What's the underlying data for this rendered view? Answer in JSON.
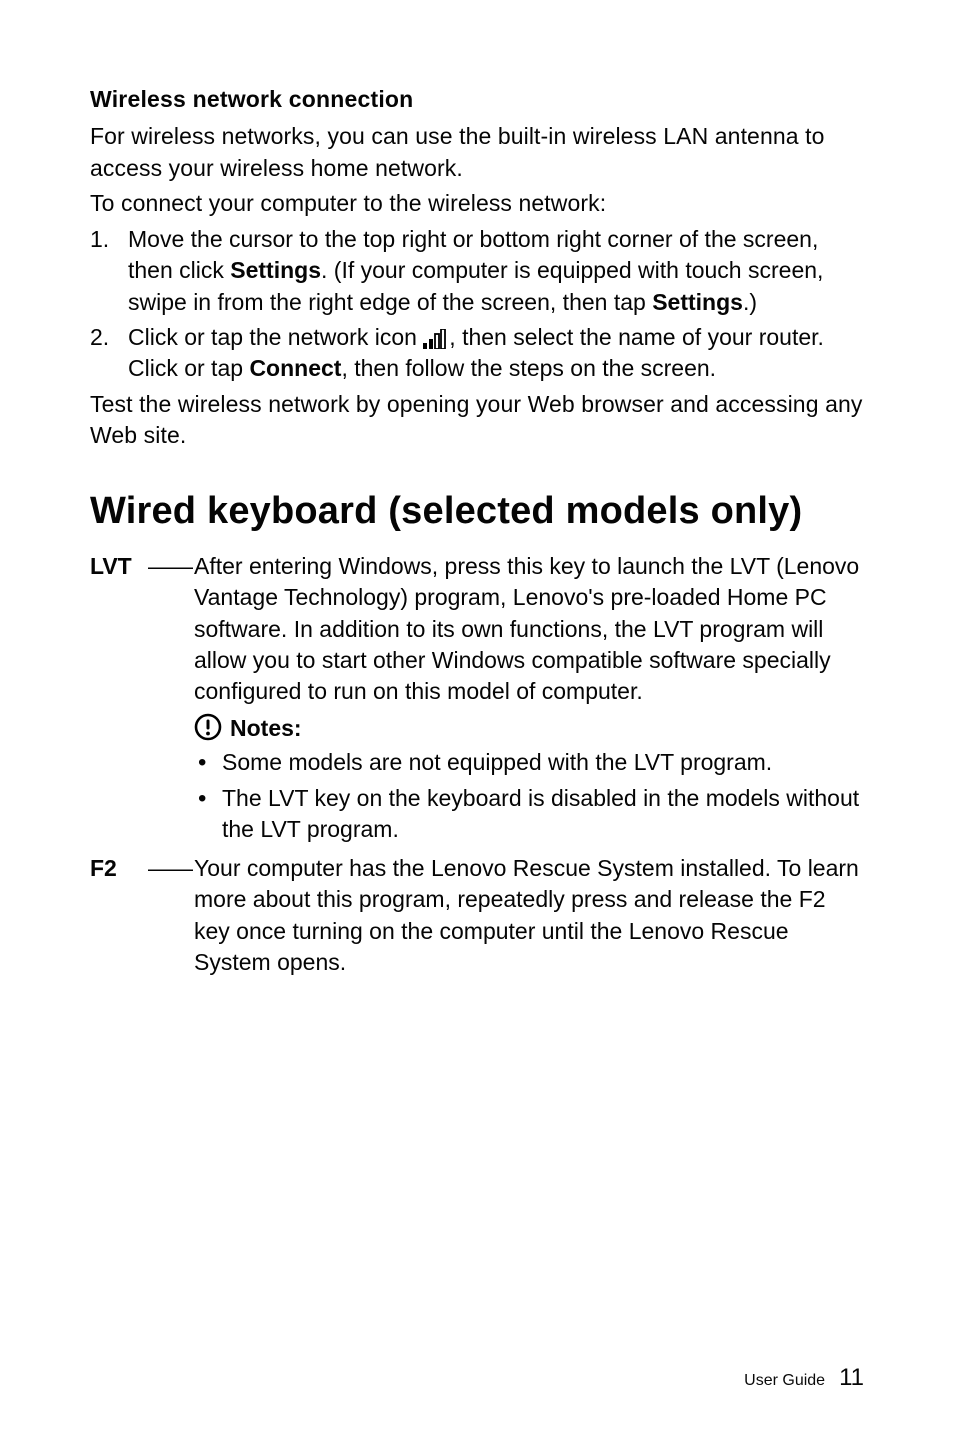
{
  "wireless": {
    "heading": "Wireless network connection",
    "intro": "For wireless networks, you can use the built-in wireless LAN antenna to access your wireless home network.",
    "instruction": "To connect your computer to the wireless network:",
    "step1pre": "Move the cursor to the top right or bottom right corner of the screen, then click ",
    "step1bold1": "Settings",
    "step1mid": ". (If your computer is equipped with touch screen, swipe in from the right edge of the screen, then tap ",
    "step1bold2": "Settings",
    "step1post": ".)",
    "step2pre": "Click or tap the network icon ",
    "step2mid": ", then select the name of your router. Click or tap ",
    "step2bold": "Connect",
    "step2post": ", then follow the steps on the screen.",
    "outro": "Test the wireless network by opening your Web browser and accessing any Web site."
  },
  "keyboard": {
    "heading": "Wired keyboard (selected models only)",
    "lvt": {
      "label": "LVT",
      "dash": "——",
      "desc": "After entering Windows, press this key to launch the LVT (Lenovo Vantage Technology) program, Lenovo's pre-loaded Home PC software. In addition to its own functions, the LVT program will allow you to start other Windows compatible software specially configured to run on this model of computer.",
      "notesLabel": "Notes:",
      "note1": "Some models are not equipped with the LVT program.",
      "note2": "The LVT key on the keyboard is disabled in the models without the LVT program."
    },
    "f2": {
      "label": "F2",
      "dash": "——",
      "desc": "Your computer has the Lenovo Rescue System installed. To learn more about this program, repeatedly press and release the F2 key once turning on the computer until the Lenovo Rescue System opens."
    }
  },
  "footer": {
    "label": "User Guide",
    "page": "11"
  }
}
